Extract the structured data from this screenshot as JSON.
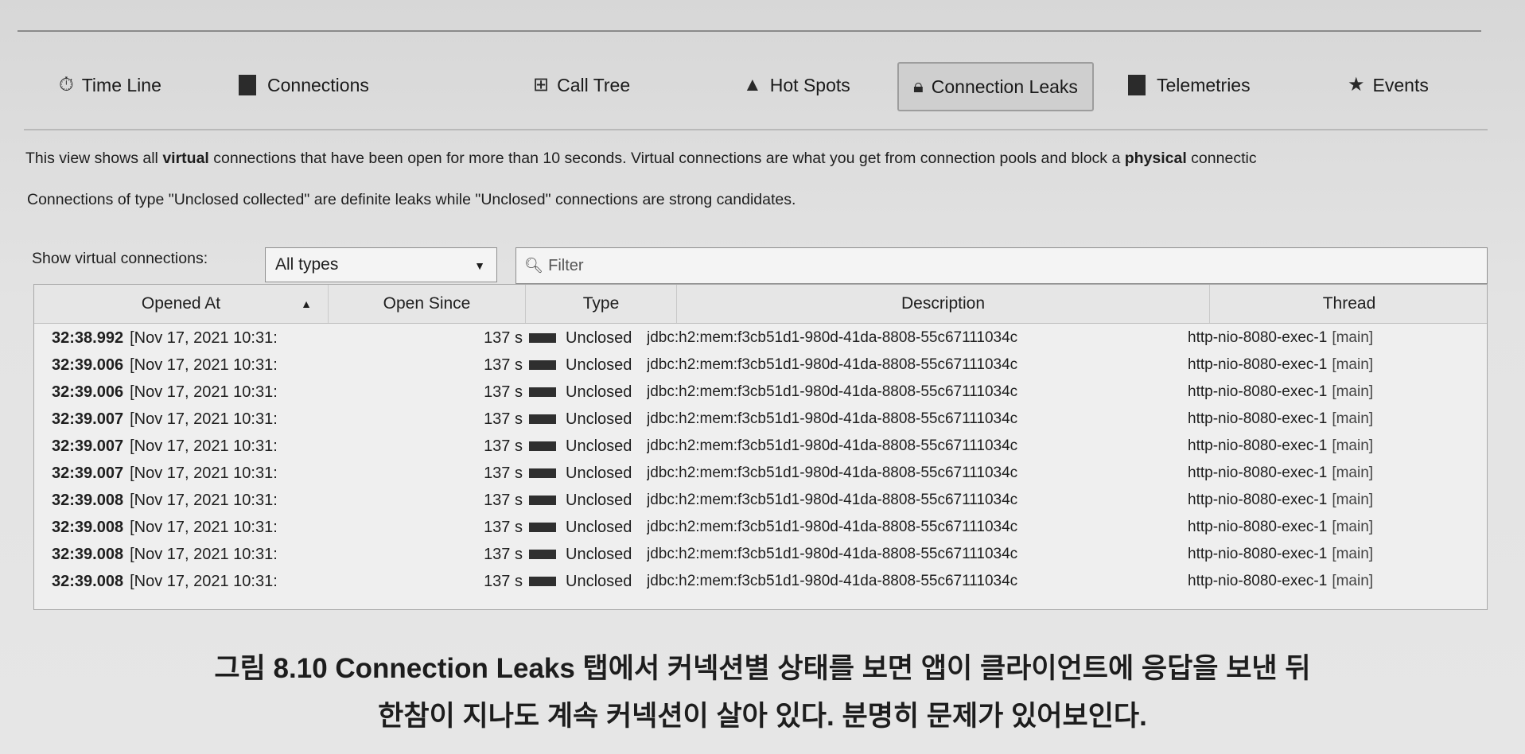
{
  "tabs": [
    {
      "label": "Time Line",
      "icon": "timeline-icon"
    },
    {
      "label": "Connections",
      "icon": "connections-icon"
    },
    {
      "label": "Call Tree",
      "icon": "call-tree-icon"
    },
    {
      "label": "Hot Spots",
      "icon": "hot-spots-icon"
    },
    {
      "label": "Connection Leaks",
      "icon": "lock-icon",
      "active": true
    },
    {
      "label": "Telemetries",
      "icon": "telemetries-icon"
    },
    {
      "label": "Events",
      "icon": "star-icon"
    }
  ],
  "info": {
    "line1_a": "This view shows all ",
    "line1_b": "virtual",
    "line1_c": " connections that have been open for more than 10 seconds. Virtual connections are what you get from connection pools and block a ",
    "line1_d": "physical",
    "line1_e": " connectic",
    "line2": "Connections of type \"Unclosed collected\" are definite leaks while \"Unclosed\" connections are strong candidates."
  },
  "controls": {
    "show_label": "Show virtual connections:",
    "select_value": "All types",
    "filter_placeholder": "Filter"
  },
  "table": {
    "columns": [
      "Opened At",
      "Open Since",
      "Type",
      "Description",
      "Thread"
    ],
    "rows": [
      {
        "time": "32:38.992",
        "date": "[Nov 17, 2021 10:31:",
        "since": "137 s",
        "type": "Unclosed",
        "desc": "jdbc:h2:mem:f3cb51d1-980d-41da-8808-55c67111034c",
        "thread": "http-nio-8080-exec-1",
        "tag": "[main]"
      },
      {
        "time": "32:39.006",
        "date": "[Nov 17, 2021 10:31:",
        "since": "137 s",
        "type": "Unclosed",
        "desc": "jdbc:h2:mem:f3cb51d1-980d-41da-8808-55c67111034c",
        "thread": "http-nio-8080-exec-1",
        "tag": "[main]"
      },
      {
        "time": "32:39.006",
        "date": "[Nov 17, 2021 10:31:",
        "since": "137 s",
        "type": "Unclosed",
        "desc": "jdbc:h2:mem:f3cb51d1-980d-41da-8808-55c67111034c",
        "thread": "http-nio-8080-exec-1",
        "tag": "[main]"
      },
      {
        "time": "32:39.007",
        "date": "[Nov 17, 2021 10:31:",
        "since": "137 s",
        "type": "Unclosed",
        "desc": "jdbc:h2:mem:f3cb51d1-980d-41da-8808-55c67111034c",
        "thread": "http-nio-8080-exec-1",
        "tag": "[main]"
      },
      {
        "time": "32:39.007",
        "date": "[Nov 17, 2021 10:31:",
        "since": "137 s",
        "type": "Unclosed",
        "desc": "jdbc:h2:mem:f3cb51d1-980d-41da-8808-55c67111034c",
        "thread": "http-nio-8080-exec-1",
        "tag": "[main]"
      },
      {
        "time": "32:39.007",
        "date": "[Nov 17, 2021 10:31:",
        "since": "137 s",
        "type": "Unclosed",
        "desc": "jdbc:h2:mem:f3cb51d1-980d-41da-8808-55c67111034c",
        "thread": "http-nio-8080-exec-1",
        "tag": "[main]"
      },
      {
        "time": "32:39.008",
        "date": "[Nov 17, 2021 10:31:",
        "since": "137 s",
        "type": "Unclosed",
        "desc": "jdbc:h2:mem:f3cb51d1-980d-41da-8808-55c67111034c",
        "thread": "http-nio-8080-exec-1",
        "tag": "[main]"
      },
      {
        "time": "32:39.008",
        "date": "[Nov 17, 2021 10:31:",
        "since": "137 s",
        "type": "Unclosed",
        "desc": "jdbc:h2:mem:f3cb51d1-980d-41da-8808-55c67111034c",
        "thread": "http-nio-8080-exec-1",
        "tag": "[main]"
      },
      {
        "time": "32:39.008",
        "date": "[Nov 17, 2021 10:31:",
        "since": "137 s",
        "type": "Unclosed",
        "desc": "jdbc:h2:mem:f3cb51d1-980d-41da-8808-55c67111034c",
        "thread": "http-nio-8080-exec-1",
        "tag": "[main]"
      },
      {
        "time": "32:39.008",
        "date": "[Nov 17, 2021 10:31:",
        "since": "137 s",
        "type": "Unclosed",
        "desc": "jdbc:h2:mem:f3cb51d1-980d-41da-8808-55c67111034c",
        "thread": "http-nio-8080-exec-1",
        "tag": "[main]"
      }
    ]
  },
  "caption": {
    "line1": "그림 8.10 Connection Leaks 탭에서 커넥션별 상태를 보면 앱이 클라이언트에 응답을 보낸 뒤",
    "line2": "한참이 지나도 계속 커넥션이 살아 있다. 분명히 문제가 있어보인다."
  }
}
